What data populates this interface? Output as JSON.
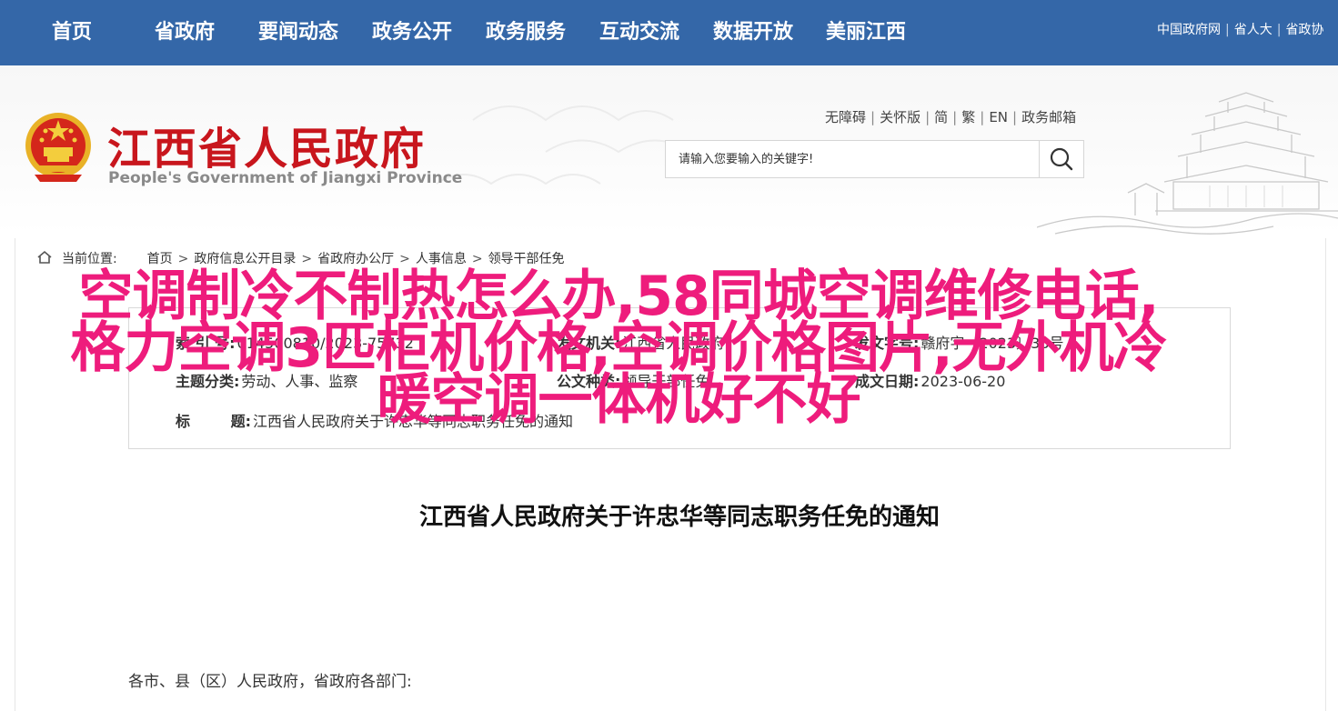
{
  "topnav": {
    "items": [
      "首页",
      "省政府",
      "要闻动态",
      "政务公开",
      "政务服务",
      "互动交流",
      "数据开放",
      "美丽江西"
    ],
    "links": [
      "中国政府网",
      "省人大",
      "省政协"
    ]
  },
  "header": {
    "title": "江西省人民政府",
    "subtitle": "People's Government of Jiangxi Province",
    "util_links": [
      "无障碍",
      "关怀版",
      "简",
      "繁",
      "EN",
      "政务邮箱"
    ],
    "search": {
      "placeholder": "请输入您要输入的关键字!"
    }
  },
  "breadcrumb": {
    "label": "当前位置:",
    "items": [
      "首页",
      "政府信息公开目录",
      "省政府办公厅",
      "人事信息",
      "领导干部任免"
    ]
  },
  "info": {
    "index_label": "索  引  号:",
    "index_value": "014500810/2023-75732",
    "docno_label": "发文机关:",
    "docno_value": "江西省人民政府",
    "wenhao_label": "发文字号:",
    "wenhao_value": "赣府字〔2023〕38号",
    "topic_label": "主题分类:",
    "topic_value": "劳动、人事、监察",
    "genre_label": "公文种类:",
    "genre_value": "领导干部任免",
    "date_label": "成文日期:",
    "date_value": "2023-06-20",
    "title_label": "标        题:",
    "title_value": "江西省人民政府关于许忠华等同志职务任免的通知"
  },
  "document": {
    "title": "江西省人民政府关于许忠华等同志职务任免的通知",
    "greeting": "各市、县（区）人民政府，省政府各部门:"
  },
  "overlay": {
    "lines": [
      "空调制冷不制热怎么办,58同城空调维修电话,",
      "格力空调3匹柜机价格,空调价格图片,无外机冷",
      "暖空调一体机好不好"
    ],
    "color": "#ee1c7c"
  },
  "colors": {
    "nav_bg": "#3467a8",
    "title_red": "#c8161d"
  }
}
